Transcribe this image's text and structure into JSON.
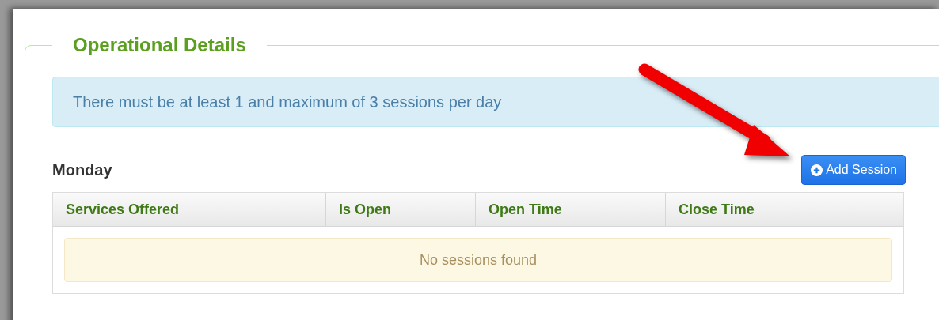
{
  "section": {
    "title": "Operational Details"
  },
  "alert": {
    "text": "There must be at least 1 and maximum of 3 sessions per day"
  },
  "day": {
    "name": "Monday",
    "add_button": "Add Session"
  },
  "table": {
    "columns": [
      "Services Offered",
      "Is Open",
      "Open Time",
      "Close Time"
    ],
    "empty_message": "No sessions found"
  }
}
